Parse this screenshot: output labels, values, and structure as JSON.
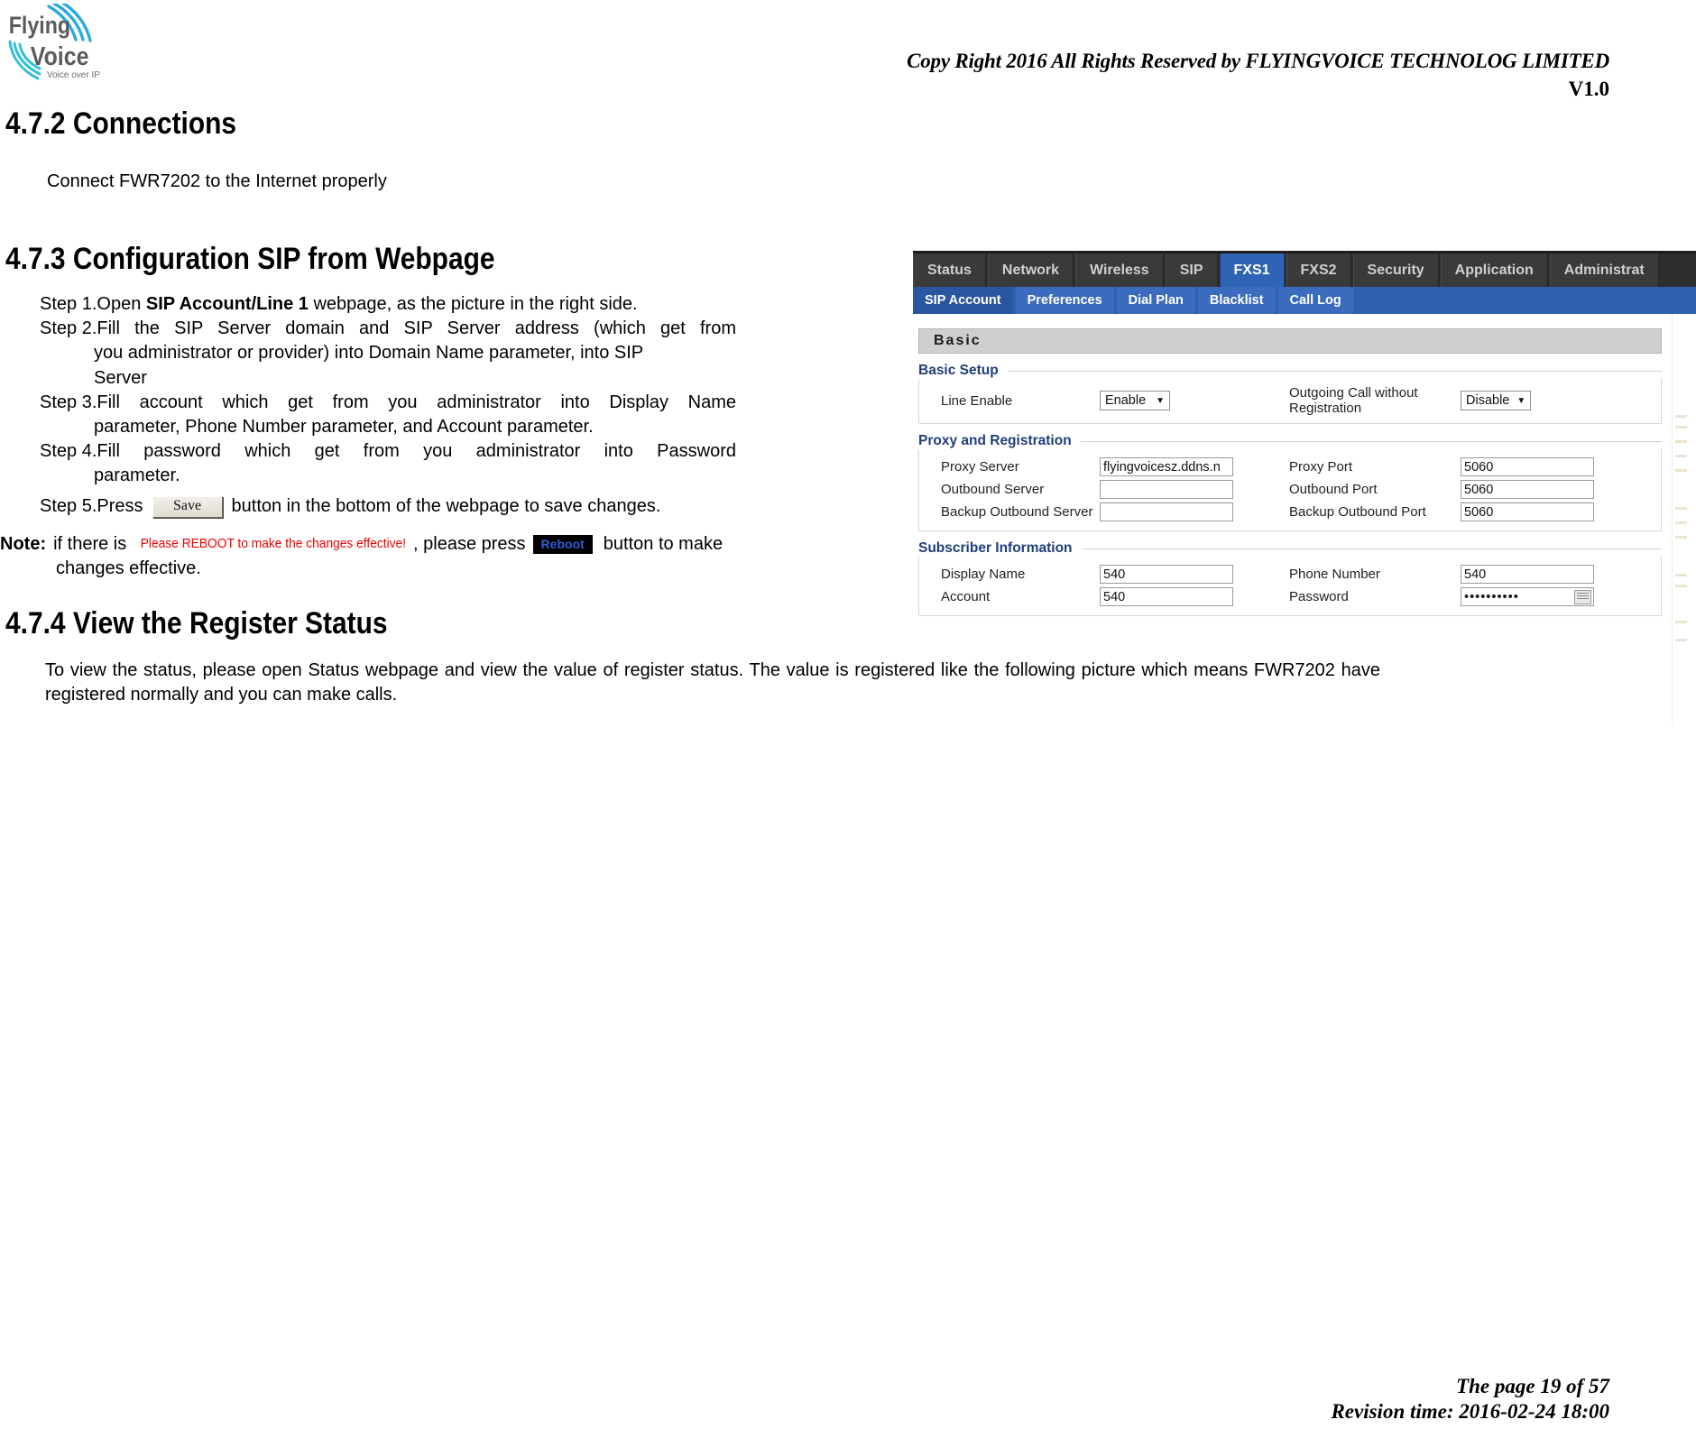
{
  "header": {
    "copyright": "Copy Right 2016 All Rights Reserved by FLYINGVOICE TECHNOLOG LIMITED",
    "version": "V1.0",
    "logo_line1": "Flying",
    "logo_line2": "Voice",
    "logo_tagline": "Voice over IP"
  },
  "sections": {
    "s472_title": "4.7.2 Connections",
    "s472_body": "Connect FWR7202 to the Internet properly",
    "s473_title": "4.7.3  Configuration SIP from Webpage",
    "s474_title": "4.7.4  View the Register Status",
    "s474_body": "To view the status, please open Status webpage and view the value of register status. The value is registered like the following picture which means FWR7202 have registered normally and you can make calls."
  },
  "steps": [
    {
      "label": "Step 1.",
      "pre": "Open ",
      "bold": "SIP Account/Line 1",
      "post": " webpage, as the picture in the right side.",
      "cont": []
    },
    {
      "label": "Step 2.",
      "pre": "Fill the SIP Server domain and SIP Server address (which get from",
      "bold": "",
      "post": "",
      "cont": [
        "you administrator or provider) into Domain Name parameter, into SIP",
        "Server"
      ]
    },
    {
      "label": "Step 3.",
      "pre": "Fill account which get from you administrator into Display Name",
      "bold": "",
      "post": "",
      "cont": [
        "parameter, Phone Number parameter, and Account parameter."
      ]
    },
    {
      "label": "Step 4.",
      "pre": "Fill password which get from you administrator into Password",
      "bold": "",
      "post": "",
      "cont": [
        "parameter."
      ]
    }
  ],
  "step5": {
    "label": "Step 5.Press",
    "button_label": "Save",
    "tail": "button in the bottom of the webpage to save changes."
  },
  "note": {
    "keyword": "Note:",
    "lead": "if there is",
    "red_text": "Please REBOOT to make the changes effective!",
    "mid": ", please press",
    "button_label": "Reboot",
    "tail": "button to make",
    "line2": "changes effective."
  },
  "webui": {
    "top_tabs": [
      {
        "label": "Status",
        "active": false
      },
      {
        "label": "Network",
        "active": false
      },
      {
        "label": "Wireless",
        "active": false
      },
      {
        "label": "SIP",
        "active": false
      },
      {
        "label": "FXS1",
        "active": true
      },
      {
        "label": "FXS2",
        "active": false
      },
      {
        "label": "Security",
        "active": false
      },
      {
        "label": "Application",
        "active": false
      },
      {
        "label": "Administrat",
        "active": false
      }
    ],
    "sub_tabs": [
      {
        "label": "SIP Account",
        "active": true
      },
      {
        "label": "Preferences",
        "active": false
      },
      {
        "label": "Dial Plan",
        "active": false
      },
      {
        "label": "Blacklist",
        "active": false
      },
      {
        "label": "Call Log",
        "active": false
      }
    ],
    "panel_title": "Basic",
    "groups": [
      {
        "title": "Basic Setup",
        "rows": [
          {
            "left_label": "Line Enable",
            "left_type": "select",
            "left_value": "Enable",
            "right_label": "Outgoing Call without Registration",
            "right_type": "select",
            "right_value": "Disable"
          }
        ]
      },
      {
        "title": "Proxy and Registration",
        "rows": [
          {
            "left_label": "Proxy Server",
            "left_type": "text",
            "left_value": "flyingvoicesz.ddns.n",
            "right_label": "Proxy Port",
            "right_type": "text",
            "right_value": "5060"
          },
          {
            "left_label": "Outbound Server",
            "left_type": "text",
            "left_value": "",
            "right_label": "Outbound Port",
            "right_type": "text",
            "right_value": "5060"
          },
          {
            "left_label": "Backup Outbound Server",
            "left_type": "text",
            "left_value": "",
            "right_label": "Backup Outbound Port",
            "right_type": "text",
            "right_value": "5060"
          }
        ]
      },
      {
        "title": "Subscriber Information",
        "rows": [
          {
            "left_label": "Display Name",
            "left_type": "text",
            "left_value": "540",
            "right_label": "Phone Number",
            "right_type": "text",
            "right_value": "540"
          },
          {
            "left_label": "Account",
            "left_type": "text",
            "left_value": "540",
            "right_label": "Password",
            "right_type": "password",
            "right_value": "••••••••••"
          }
        ]
      }
    ]
  },
  "footer": {
    "page": "The page 19 of 57",
    "revision": "Revision time: 2016-02-24 18:00"
  },
  "colors": {
    "nav_active": "#2f63b3",
    "subnav": "#2f5fae",
    "group_title": "#1f3e7a",
    "note_red": "#ee0000",
    "reboot_text": "#2b5fd9"
  }
}
